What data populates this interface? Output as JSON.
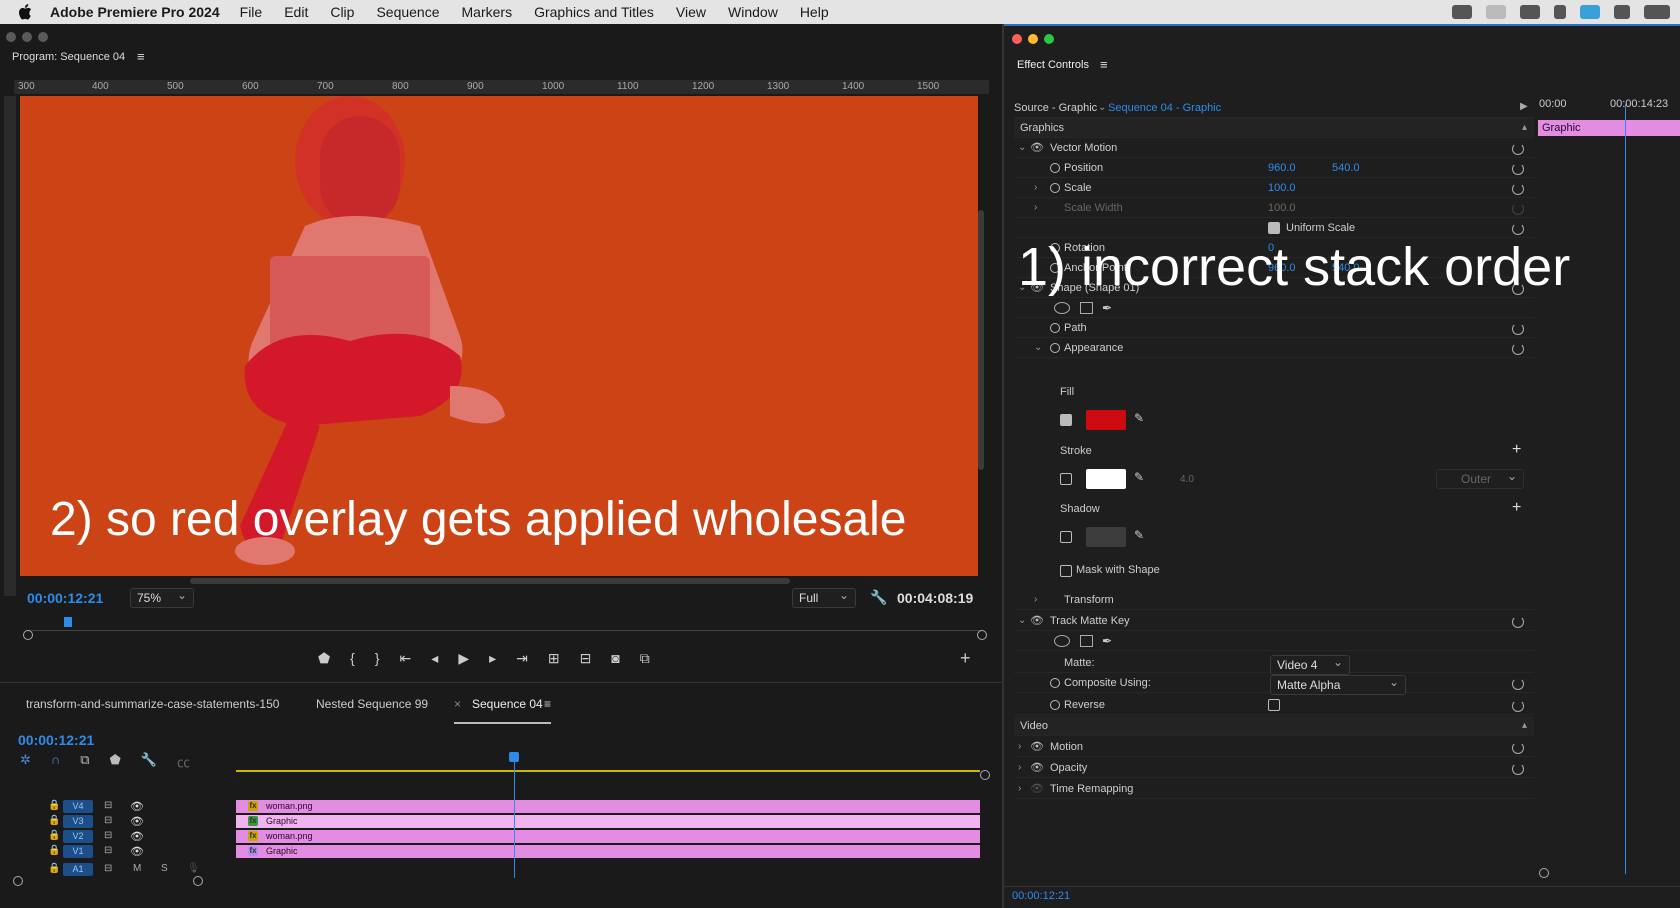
{
  "menubar": {
    "app_name": "Adobe Premiere Pro 2024",
    "items": [
      "File",
      "Edit",
      "Clip",
      "Sequence",
      "Markers",
      "Graphics and Titles",
      "View",
      "Window",
      "Help"
    ]
  },
  "program_monitor": {
    "title": "Program: Sequence 04",
    "ruler_labels": [
      "300",
      "400",
      "500",
      "600",
      "700",
      "800",
      "900",
      "1000",
      "1100",
      "1200",
      "1300",
      "1400",
      "1500"
    ],
    "timecode": "00:00:12:21",
    "zoom": "75%",
    "quality": "Full",
    "duration": "00:04:08:19"
  },
  "annotations": {
    "text1": "1) incorrect stack order",
    "text2": "2) so red overlay gets applied wholesale"
  },
  "timeline": {
    "tabs": [
      "transform-and-summarize-case-statements-150",
      "Nested Sequence 99",
      "Sequence 04"
    ],
    "timecode": "00:00:12:21",
    "tracks": [
      {
        "label": "V4",
        "clip": "woman.png"
      },
      {
        "label": "V3",
        "clip": "Graphic"
      },
      {
        "label": "V2",
        "clip": "woman.png"
      },
      {
        "label": "V1",
        "clip": "Graphic"
      },
      {
        "label": "A1",
        "clip": ""
      }
    ],
    "audio_buttons": {
      "m": "M",
      "s": "S"
    }
  },
  "effect_controls": {
    "title": "Effect Controls",
    "source": "Source - Graphic",
    "sequence": "Sequence 04 - Graphic",
    "mini_timeline": {
      "start": "00:00",
      "marker": "00:00:14:23",
      "clip": "Graphic"
    },
    "section_graphics": "Graphics",
    "vector_motion": "Vector Motion",
    "position_label": "Position",
    "position_x": "960.0",
    "position_y": "540.0",
    "scale_label": "Scale",
    "scale_val": "100.0",
    "scale_width_label": "Scale Width",
    "scale_width_val": "100.0",
    "uniform_scale": "Uniform Scale",
    "rotation_label": "Rotation",
    "rotation_val": "0",
    "anchor_label": "Anchor Point",
    "anchor_x": "960.0",
    "anchor_y": "540.0",
    "shape": "Shape (Shape 01)",
    "path": "Path",
    "appearance": "Appearance",
    "fill": "Fill",
    "stroke": "Stroke",
    "stroke_width": "4.0",
    "stroke_pos": "Outer",
    "shadow": "Shadow",
    "mask_with_shape": "Mask with Shape",
    "transform": "Transform",
    "track_matte_key": "Track Matte Key",
    "matte_label": "Matte:",
    "matte_val": "Video 4",
    "composite_label": "Composite Using:",
    "composite_val": "Matte Alpha",
    "reverse_label": "Reverse",
    "section_video": "Video",
    "motion": "Motion",
    "opacity": "Opacity",
    "time_remapping": "Time Remapping",
    "footer_tc": "00:00:12:21"
  },
  "colors": {
    "fill_red": "#cc0a10",
    "bg_orange": "#cc4315",
    "accent": "#2d8ceb",
    "clip_pink": "#e28ce2"
  }
}
